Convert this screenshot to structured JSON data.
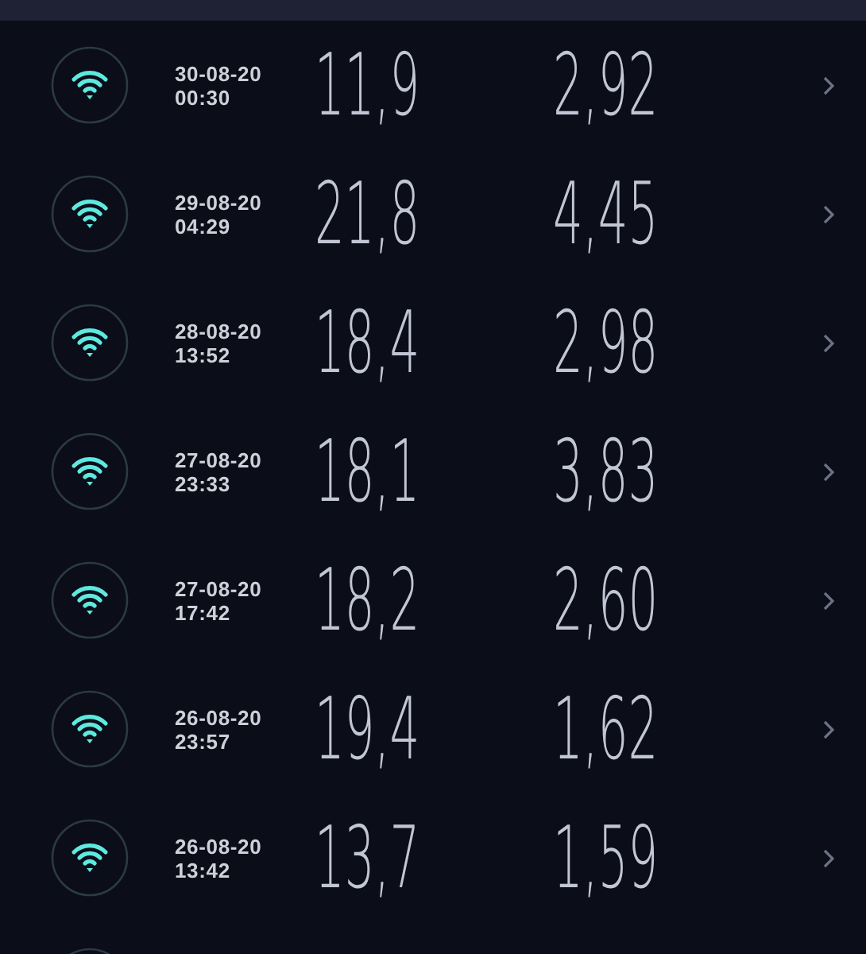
{
  "rows": [
    {
      "date": "30-08-20",
      "time": "00:30",
      "download": "11,9",
      "upload": "2,92"
    },
    {
      "date": "29-08-20",
      "time": "04:29",
      "download": "21,8",
      "upload": "4,45"
    },
    {
      "date": "28-08-20",
      "time": "13:52",
      "download": "18,4",
      "upload": "2,98"
    },
    {
      "date": "27-08-20",
      "time": "23:33",
      "download": "18,1",
      "upload": "3,83"
    },
    {
      "date": "27-08-20",
      "time": "17:42",
      "download": "18,2",
      "upload": "2,60"
    },
    {
      "date": "26-08-20",
      "time": "23:57",
      "download": "19,4",
      "upload": "1,62"
    },
    {
      "date": "26-08-20",
      "time": "13:42",
      "download": "13,7",
      "upload": "1,59"
    }
  ]
}
